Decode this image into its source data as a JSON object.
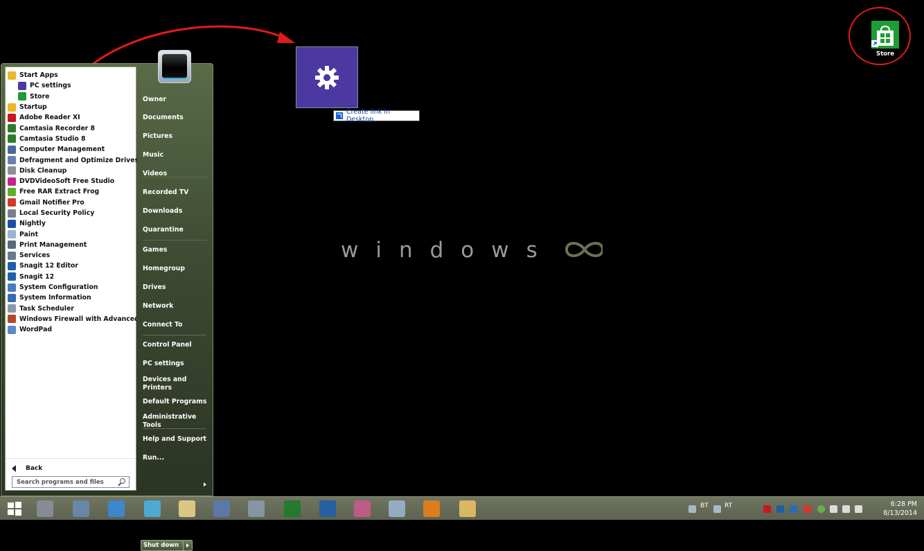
{
  "start_menu": {
    "programs": [
      {
        "label": "Start Apps",
        "icon": "folder-icon",
        "color": "#e8b82a",
        "sub": false
      },
      {
        "label": "PC settings",
        "icon": "gear-icon",
        "color": "#4b38a0",
        "sub": true
      },
      {
        "label": "Store",
        "icon": "store-icon",
        "color": "#1f9c38",
        "sub": true
      },
      {
        "label": "Startup",
        "icon": "folder-icon",
        "color": "#e8b82a",
        "sub": false
      },
      {
        "label": "Adobe Reader XI",
        "icon": "adobe-icon",
        "color": "#c8171e",
        "sub": false
      },
      {
        "label": "Camtasia Recorder 8",
        "icon": "camtasia-recorder-icon",
        "color": "#2f7d2a",
        "sub": false
      },
      {
        "label": "Camtasia Studio 8",
        "icon": "camtasia-studio-icon",
        "color": "#2f7d2a",
        "sub": false
      },
      {
        "label": "Computer Management",
        "icon": "computer-management-icon",
        "color": "#4a6a9a",
        "sub": false
      },
      {
        "label": "Defragment and Optimize Drives",
        "icon": "defrag-icon",
        "color": "#6a7fb0",
        "sub": false
      },
      {
        "label": "Disk Cleanup",
        "icon": "disk-cleanup-icon",
        "color": "#8a8f9a",
        "sub": false
      },
      {
        "label": "DVDVideoSoft Free Studio",
        "icon": "dvdvideosoft-icon",
        "color": "#c0268a",
        "sub": false
      },
      {
        "label": "Free RAR Extract Frog",
        "icon": "frog-icon",
        "color": "#5fae2a",
        "sub": false
      },
      {
        "label": "Gmail Notifier Pro",
        "icon": "gmail-icon",
        "color": "#d2392b",
        "sub": false
      },
      {
        "label": "Local Security Policy",
        "icon": "security-policy-icon",
        "color": "#7a7f8a",
        "sub": false
      },
      {
        "label": "Nightly",
        "icon": "nightly-icon",
        "color": "#1e4fa0",
        "sub": false
      },
      {
        "label": "Paint",
        "icon": "paint-icon",
        "color": "#9bb3d0",
        "sub": false
      },
      {
        "label": "Print Management",
        "icon": "print-management-icon",
        "color": "#5a6a7a",
        "sub": false
      },
      {
        "label": "Services",
        "icon": "services-icon",
        "color": "#6a7a8a",
        "sub": false
      },
      {
        "label": "Snagit 12 Editor",
        "icon": "snagit-editor-icon",
        "color": "#1f5fa8",
        "sub": false
      },
      {
        "label": "Snagit 12",
        "icon": "snagit-icon",
        "color": "#1f5fa8",
        "sub": false
      },
      {
        "label": "System Configuration",
        "icon": "system-configuration-icon",
        "color": "#4a7ac0",
        "sub": false
      },
      {
        "label": "System Information",
        "icon": "system-information-icon",
        "color": "#3a6ab0",
        "sub": false
      },
      {
        "label": "Task Scheduler",
        "icon": "task-scheduler-icon",
        "color": "#8a9aaa",
        "sub": false
      },
      {
        "label": "Windows Firewall with Advanced Security",
        "icon": "firewall-icon",
        "color": "#b04a2a",
        "sub": false
      },
      {
        "label": "WordPad",
        "icon": "wordpad-icon",
        "color": "#5a8ac8",
        "sub": false
      }
    ],
    "back_label": "Back",
    "search_placeholder": "Search programs and files",
    "places": [
      "Owner",
      "Documents",
      "Pictures",
      "Music",
      "Videos",
      "Recorded TV",
      "Downloads",
      "Quarantine",
      "Games",
      "Homegroup",
      "Drives",
      "Network",
      "Connect To",
      "Control Panel",
      "PC settings",
      "Devices and\nPrinters",
      "Default Programs",
      "Administrative\nTools",
      "Help and Support",
      "Run..."
    ],
    "shutdown_label": "Shut down"
  },
  "dragged_tile": {
    "icon": "gear-icon",
    "color": "#4b38a0"
  },
  "tooltip": {
    "text": "Create link in Desktop"
  },
  "desktop_icon": {
    "label": "Store",
    "icon": "store-icon",
    "color": "#1f9c38"
  },
  "logo": {
    "text": "windows"
  },
  "annotation_color": "#e21a1a",
  "taskbar": {
    "pinned": [
      "start-button-icon",
      "server-manager-icon",
      "remote-desktop-icon",
      "control-panel-icon",
      "apps-icon",
      "notepad-icon",
      "monitor-icon",
      "calculator-icon",
      "camtasia-icon",
      "snagit-icon",
      "snipping-tool-icon",
      "pencil-icon",
      "media-player-icon",
      "file-explorer-icon"
    ],
    "tray_labels": [
      "BT",
      "RT"
    ],
    "time": "6:28 PM",
    "date": "8/13/2014"
  }
}
